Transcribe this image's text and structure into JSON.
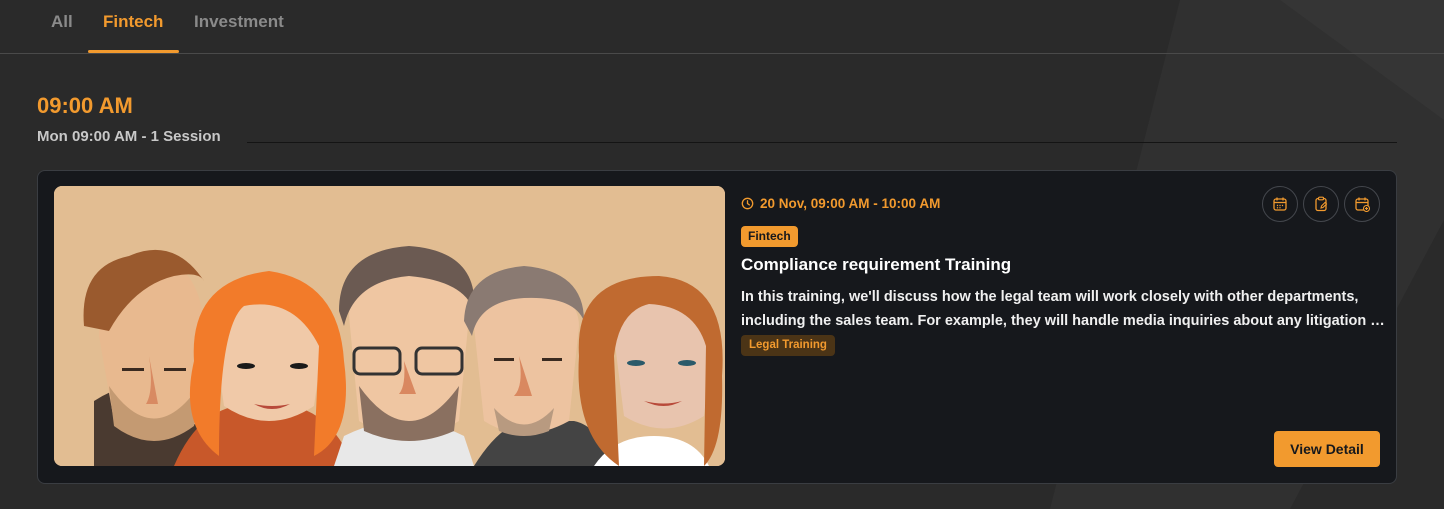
{
  "tabs": [
    {
      "label": "All",
      "active": false
    },
    {
      "label": "Fintech",
      "active": true
    },
    {
      "label": "Investment",
      "active": false
    }
  ],
  "schedule": {
    "time": "09:00 AM",
    "subtitle": "Mon 09:00 AM - 1  Session"
  },
  "session_card": {
    "datetime": "20 Nov, 09:00 AM - 10:00 AM",
    "category_tag": "Fintech",
    "title": "Compliance requirement Training",
    "description": "In this training, we'll discuss how the legal team will work closely with other departments, including the sales team. For example, they will handle media inquiries about any litigation or regulatory matters.",
    "topic_tag": "Legal Training",
    "view_button": "View Detail",
    "actions": [
      "calendar-icon",
      "clipboard-edit-icon",
      "calendar-add-icon"
    ]
  },
  "colors": {
    "accent": "#f29a2e",
    "background": "#2a2a2a",
    "card": "#16181c"
  }
}
